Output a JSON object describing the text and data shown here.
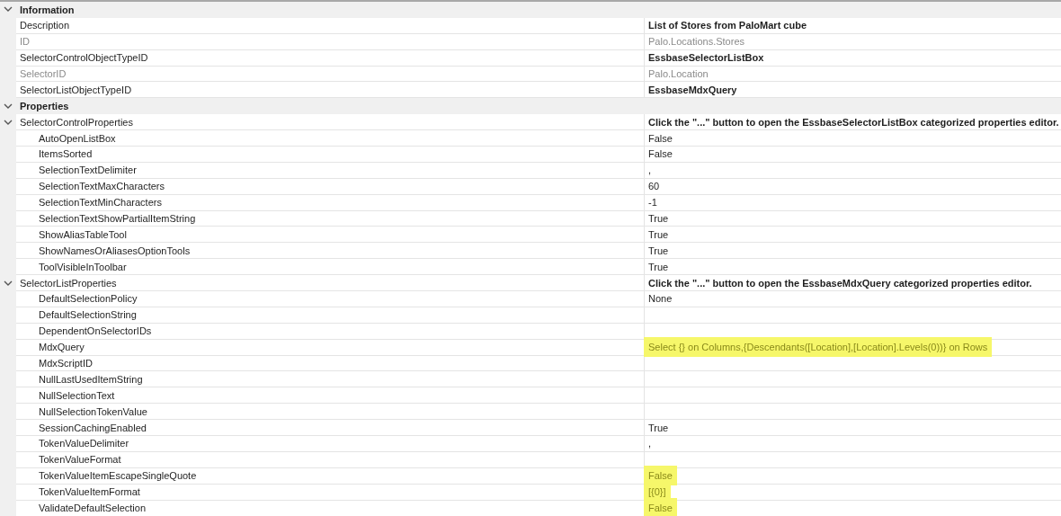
{
  "categories": [
    {
      "name": "Information",
      "expanded": true,
      "rows": [
        {
          "name": "Description",
          "value": "List of Stores from PaloMart cube",
          "modified": true,
          "readonly": false,
          "highlighted": false
        },
        {
          "name": "ID",
          "value": "Palo.Locations.Stores",
          "modified": false,
          "readonly": true,
          "highlighted": false
        },
        {
          "name": "SelectorControlObjectTypeID",
          "value": "EssbaseSelectorListBox",
          "modified": true,
          "readonly": false,
          "highlighted": false
        },
        {
          "name": "SelectorID",
          "value": "Palo.Location",
          "modified": false,
          "readonly": true,
          "highlighted": false
        },
        {
          "name": "SelectorListObjectTypeID",
          "value": "EssbaseMdxQuery",
          "modified": true,
          "readonly": false,
          "highlighted": false
        }
      ]
    },
    {
      "name": "Properties",
      "expanded": true,
      "rows": [
        {
          "name": "SelectorControlProperties",
          "value": "Click the \"...\" button to open the EssbaseSelectorListBox categorized properties editor.",
          "modified": true,
          "readonly": false,
          "highlighted": false,
          "expanded": true,
          "children": [
            {
              "name": "AutoOpenListBox",
              "value": "False",
              "modified": false,
              "readonly": false,
              "highlighted": false
            },
            {
              "name": "ItemsSorted",
              "value": "False",
              "modified": false,
              "readonly": false,
              "highlighted": false
            },
            {
              "name": "SelectionTextDelimiter",
              "value": ",",
              "modified": false,
              "readonly": false,
              "highlighted": false
            },
            {
              "name": "SelectionTextMaxCharacters",
              "value": "60",
              "modified": false,
              "readonly": false,
              "highlighted": false
            },
            {
              "name": "SelectionTextMinCharacters",
              "value": "-1",
              "modified": false,
              "readonly": false,
              "highlighted": false
            },
            {
              "name": "SelectionTextShowPartialItemString",
              "value": "True",
              "modified": false,
              "readonly": false,
              "highlighted": false
            },
            {
              "name": "ShowAliasTableTool",
              "value": "True",
              "modified": false,
              "readonly": false,
              "highlighted": false
            },
            {
              "name": "ShowNamesOrAliasesOptionTools",
              "value": "True",
              "modified": false,
              "readonly": false,
              "highlighted": false
            },
            {
              "name": "ToolVisibleInToolbar",
              "value": "True",
              "modified": false,
              "readonly": false,
              "highlighted": false
            }
          ]
        },
        {
          "name": "SelectorListProperties",
          "value": "Click the \"...\" button to open the EssbaseMdxQuery categorized properties editor.",
          "modified": true,
          "readonly": false,
          "highlighted": false,
          "expanded": true,
          "children": [
            {
              "name": "DefaultSelectionPolicy",
              "value": "None",
              "modified": false,
              "readonly": false,
              "highlighted": false
            },
            {
              "name": "DefaultSelectionString",
              "readonly": false
            },
            {
              "name": "DependentOnSelectorIDs",
              "readonly": false
            },
            {
              "name": "MdxQuery",
              "value": "Select {} on Columns,{Descendants([Location],[Location].Levels(0))} on Rows",
              "modified": false,
              "readonly": false,
              "highlighted": true
            },
            {
              "name": "MdxScriptID",
              "readonly": false
            },
            {
              "name": "NullLastUsedItemString",
              "readonly": false
            },
            {
              "name": "NullSelectionText",
              "readonly": false
            },
            {
              "name": "NullSelectionTokenValue",
              "readonly": false
            },
            {
              "name": "SessionCachingEnabled",
              "value": "True",
              "modified": false,
              "readonly": false,
              "highlighted": false
            },
            {
              "name": "TokenValueDelimiter",
              "value": ",",
              "modified": false,
              "readonly": false,
              "highlighted": false
            },
            {
              "name": "TokenValueFormat",
              "readonly": false
            },
            {
              "name": "TokenValueItemEscapeSingleQuote",
              "value": "False",
              "modified": false,
              "readonly": false,
              "highlighted": true
            },
            {
              "name": "TokenValueItemFormat",
              "value": "[{0}]",
              "modified": false,
              "readonly": false,
              "highlighted": true
            },
            {
              "name": "ValidateDefaultSelection",
              "value": "False",
              "modified": false,
              "readonly": false,
              "highlighted": true
            }
          ]
        }
      ]
    }
  ]
}
